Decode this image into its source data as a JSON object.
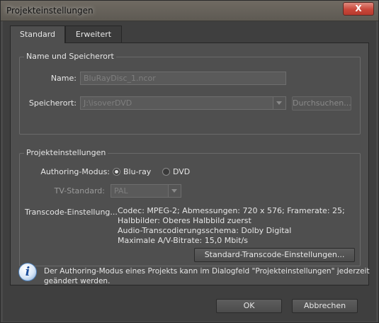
{
  "window": {
    "title": "Projekteinstellungen",
    "close_glyph": "X"
  },
  "tabs": [
    {
      "label": "Standard",
      "active": true
    },
    {
      "label": "Erweitert",
      "active": false
    }
  ],
  "location_group": {
    "title": "Name und Speicherort",
    "name_label": "Name:",
    "name_value": "BluRayDisc_1.ncor",
    "location_label": "Speicherort:",
    "location_value": "J:\\isoverDVD",
    "browse_label": "Durchsuchen..."
  },
  "settings_group": {
    "title": "Projekteinstellungen",
    "authoring_label": "Authoring-Modus:",
    "authoring_options": [
      {
        "label": "Blu-ray",
        "checked": true
      },
      {
        "label": "DVD",
        "checked": false
      }
    ],
    "tv_label": "TV-Standard:",
    "tv_value": "PAL",
    "transcode_label": "Transcode-Einstellung...",
    "transcode_lines": [
      "Codec: MPEG-2; Abmessungen: 720 x 576; Framerate: 25;",
      "Halbbilder: Oberes Halbbild zuerst",
      "Audio-Transcodierungsschema: Dolby Digital",
      "Maximale A/V-Bitrate: 15,0 Mbit/s"
    ],
    "transcode_button": "Standard-Transcode-Einstellungen..."
  },
  "info": {
    "icon": "info-icon",
    "text_line1": "Der Authoring-Modus eines Projekts kann im Dialogfeld \"Projekteinstellungen\" jederzeit",
    "text_line2": "geändert werden."
  },
  "footer": {
    "ok_label": "OK",
    "cancel_label": "Abbrechen"
  }
}
